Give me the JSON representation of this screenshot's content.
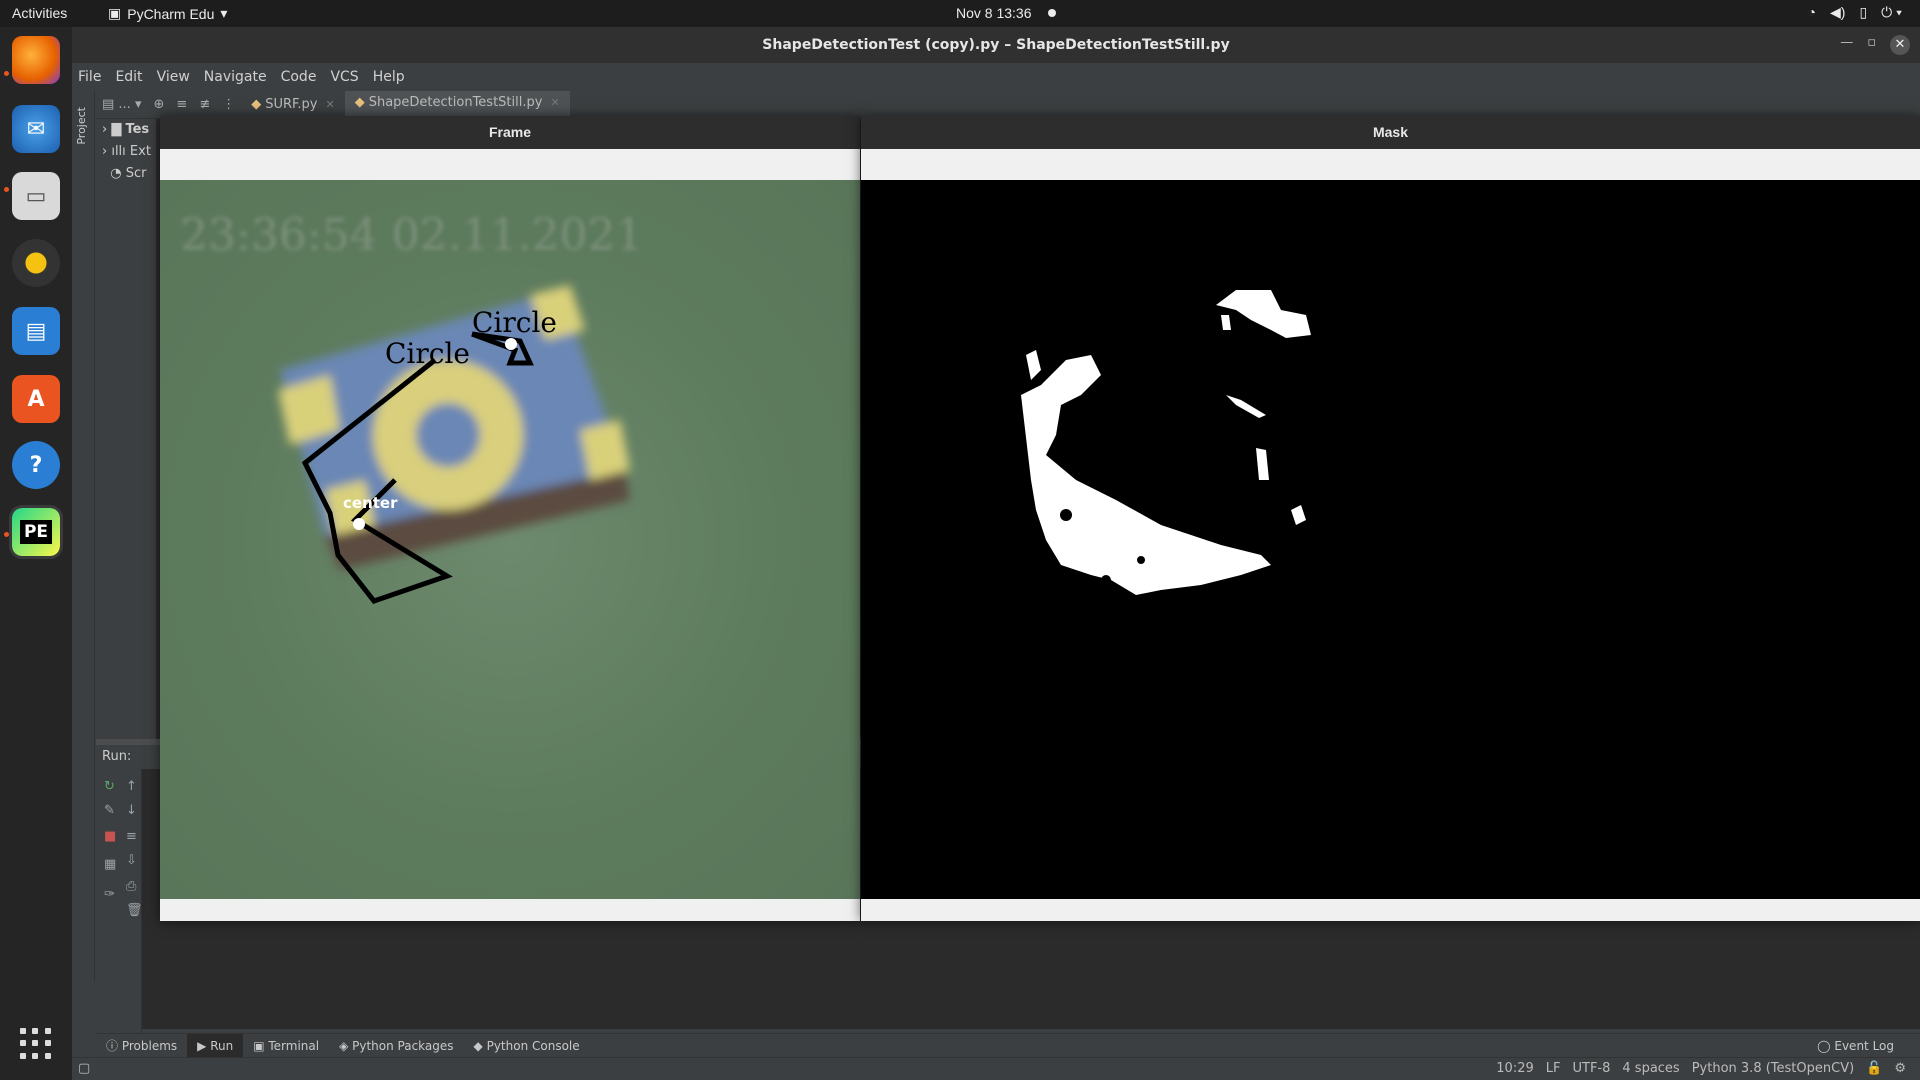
{
  "topbar": {
    "activities": "Activities",
    "app_name": "PyCharm Edu",
    "clock": "Nov 8  13:36",
    "tray_icons": [
      "wifi-icon",
      "volume-icon",
      "battery-icon",
      "power-icon"
    ]
  },
  "dock": {
    "apps": [
      "firefox",
      "thunderbird",
      "files",
      "rhythmbox",
      "libreoffice-writer",
      "ubuntu-software",
      "help",
      "pycharm-edu"
    ],
    "pycharm_label": "PE"
  },
  "window": {
    "title": "ShapeDetectionTest (copy).py – ShapeDetectionTestStill.py"
  },
  "menu": [
    "File",
    "Edit",
    "View",
    "Navigate",
    "Code",
    "VCS",
    "Help"
  ],
  "sidebar_stripe": {
    "project_label": "Project"
  },
  "editor_tabs": [
    {
      "label": "SURF.py",
      "active": false
    },
    {
      "label": "ShapeDetectionTestStill.py",
      "active": true
    }
  ],
  "toolbar": {
    "dropdown": "..."
  },
  "project_tree": [
    "Tes",
    "Ext",
    "Scr"
  ],
  "run_panel": {
    "label": "Run:"
  },
  "bottom_tabs": [
    "Problems",
    "Run",
    "Terminal",
    "Python Packages",
    "Python Console"
  ],
  "event_log": "Event Log",
  "status": {
    "position": "10:29",
    "line_sep": "LF",
    "encoding": "UTF-8",
    "indent": "4 spaces",
    "interpreter": "Python 3.8 (TestOpenCV)"
  },
  "frame_window": {
    "title": "Frame",
    "timestamp_overlay": "23:36:54 02.11.2021",
    "label_circle_1": "Circle",
    "label_circle_2": "Circle",
    "label_center": "center"
  },
  "mask_window": {
    "title": "Mask"
  }
}
